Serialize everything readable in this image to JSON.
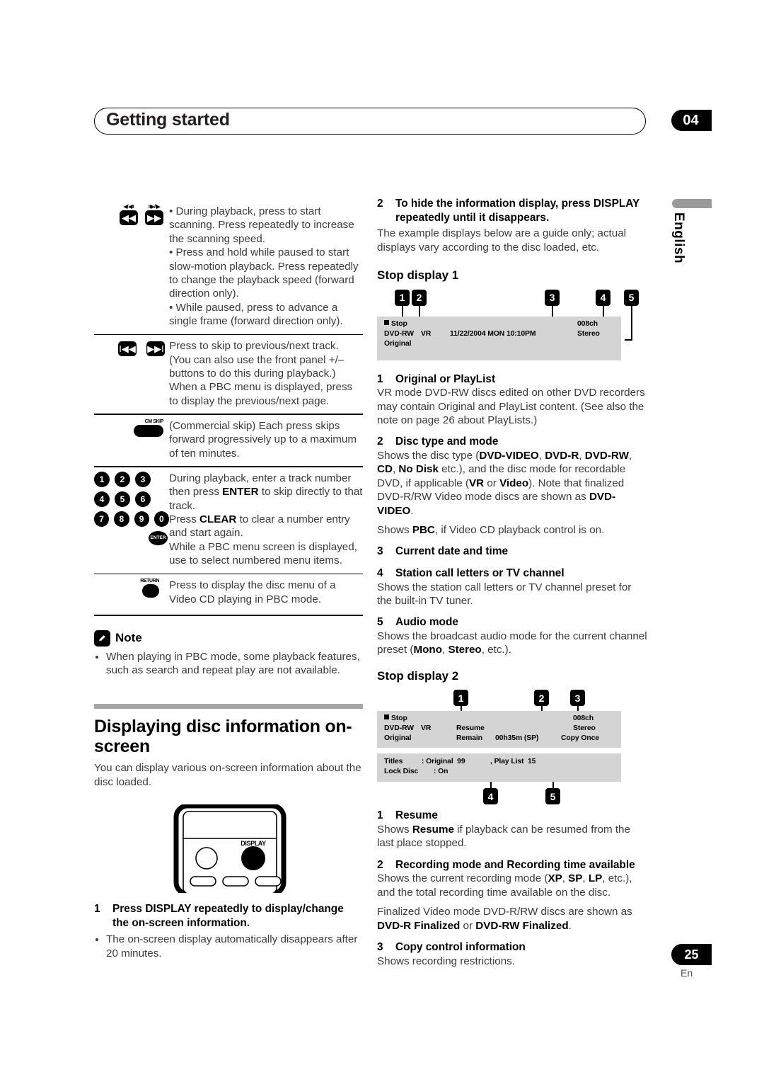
{
  "header": {
    "title": "Getting started",
    "chapter": "04",
    "language_tab": "English"
  },
  "footer": {
    "page_number": "25",
    "lang_code": "En"
  },
  "left_column": {
    "button_rows": [
      {
        "icons": [
          "scan-reverse-button",
          "scan-forward-button"
        ],
        "icon_mini_labels": [
          "◀/◀II",
          "II▶/I▶"
        ],
        "icon_glyphs": [
          "◀◀",
          "▶▶"
        ],
        "paragraphs": [
          "• During playback, press to start scanning. Press repeatedly to increase the scanning speed.",
          "• Press and hold while paused to start slow-motion playback. Press repeatedly to change the playback speed (forward direction only).",
          "• While paused, press to advance a single frame (forward direction only)."
        ]
      },
      {
        "icons": [
          "previous-track-button",
          "next-track-button"
        ],
        "icon_glyphs": [
          "I◀◀",
          "▶▶I"
        ],
        "paragraphs": [
          "Press to skip to previous/next track. (You can also use the front panel +/– buttons to do this during playback.)",
          "When a PBC menu is displayed, press to display the previous/next page."
        ]
      },
      {
        "icons": [
          "cm-skip-button"
        ],
        "icon_label": "CM SKIP",
        "paragraphs": [
          "(Commercial skip) Each press skips forward progressively up to a maximum of ten minutes."
        ]
      },
      {
        "icons": [
          "number-buttons",
          "enter-button"
        ],
        "number_keys": [
          [
            "1",
            "2",
            "3"
          ],
          [
            "4",
            "5",
            "6"
          ],
          [
            "7",
            "8",
            "9",
            "0"
          ]
        ],
        "enter_label": "ENTER",
        "paragraphs": [
          "During playback, enter a track number then press ENTER to skip directly to that track.",
          "Press CLEAR to clear a number entry and start again.",
          "While a PBC menu screen is displayed, use to select numbered menu items."
        ]
      },
      {
        "icons": [
          "return-button"
        ],
        "icon_label": "RETURN",
        "paragraphs": [
          "Press to display the disc menu of a Video CD playing in PBC mode."
        ]
      }
    ],
    "note": {
      "heading": "Note",
      "items": [
        "When playing in PBC mode, some playback features, such as search and repeat play are not available."
      ]
    },
    "section": {
      "heading": "Displaying disc information on-screen",
      "intro": "You can display various on-screen information about the disc loaded.",
      "remote_button_label": "DISPLAY",
      "step_number": "1",
      "step_text": "Press DISPLAY repeatedly to display/change the on-screen information.",
      "step_bullets": [
        "The on-screen display automatically disappears after 20 minutes."
      ]
    }
  },
  "right_column": {
    "step2": {
      "number": "2",
      "title": "To hide the information display, press DISPLAY repeatedly until it disappears.",
      "body": "The example displays below are a guide only; actual displays vary according to the disc loaded, etc."
    },
    "stop_display_1": {
      "heading": "Stop display 1",
      "callouts": [
        "1",
        "2",
        "3",
        "4",
        "5"
      ],
      "osd": {
        "status": "Stop",
        "disc_type": "DVD-RW",
        "disc_mode": "VR",
        "content": "Original",
        "datetime": "11/22/2004 MON 10:10PM",
        "channel": "008ch",
        "audio": "Stereo"
      },
      "items": [
        {
          "num": "1",
          "title": "Original or PlayList",
          "body": "VR mode DVD-RW discs edited on other DVD recorders may contain Original and PlayList content. (See also the note on page 26 about PlayLists.)"
        },
        {
          "num": "2",
          "title": "Disc type and mode",
          "body": "Shows the disc type (DVD-VIDEO, DVD-R, DVD-RW, CD, No Disk etc.), and the disc mode for recordable DVD, if applicable (VR or Video). Note that finalized DVD-R/RW Video mode discs are shown as DVD-VIDEO.",
          "body2": "Shows PBC, if Video CD playback control is on."
        },
        {
          "num": "3",
          "title": "Current date and time",
          "body": ""
        },
        {
          "num": "4",
          "title": "Station call letters or TV channel",
          "body": "Shows the station call letters or TV channel preset for the built-in TV tuner."
        },
        {
          "num": "5",
          "title": "Audio mode",
          "body": "Shows the broadcast audio mode for the current channel preset (Mono, Stereo, etc.)."
        }
      ]
    },
    "stop_display_2": {
      "heading": "Stop display 2",
      "callouts": [
        "1",
        "2",
        "3",
        "4",
        "5"
      ],
      "osd_top": {
        "status": "Stop",
        "disc_type": "DVD-RW",
        "disc_mode": "VR",
        "content": "Original",
        "resume": "Resume",
        "remain_label": "Remain",
        "remain_value": "00h35m (SP)",
        "channel": "008ch",
        "audio": "Stereo",
        "copy": "Copy Once"
      },
      "osd_bottom": {
        "titles_label": "Titles",
        "titles_value": ": Original  99",
        "playlist_value": ", Play List  15",
        "lock_label": "Lock Disc",
        "lock_value": ": On"
      },
      "items": [
        {
          "num": "1",
          "title": "Resume",
          "body": "Shows Resume if playback can be resumed from the last place stopped."
        },
        {
          "num": "2",
          "title": "Recording mode and Recording time available",
          "body": "Shows the current recording mode (XP, SP, LP, etc.), and the total recording time available on the disc.",
          "body2": "Finalized Video mode DVD-R/RW discs are shown as DVD-R Finalized or DVD-RW Finalized."
        },
        {
          "num": "3",
          "title": "Copy control information",
          "body": "Shows recording restrictions."
        }
      ]
    }
  }
}
